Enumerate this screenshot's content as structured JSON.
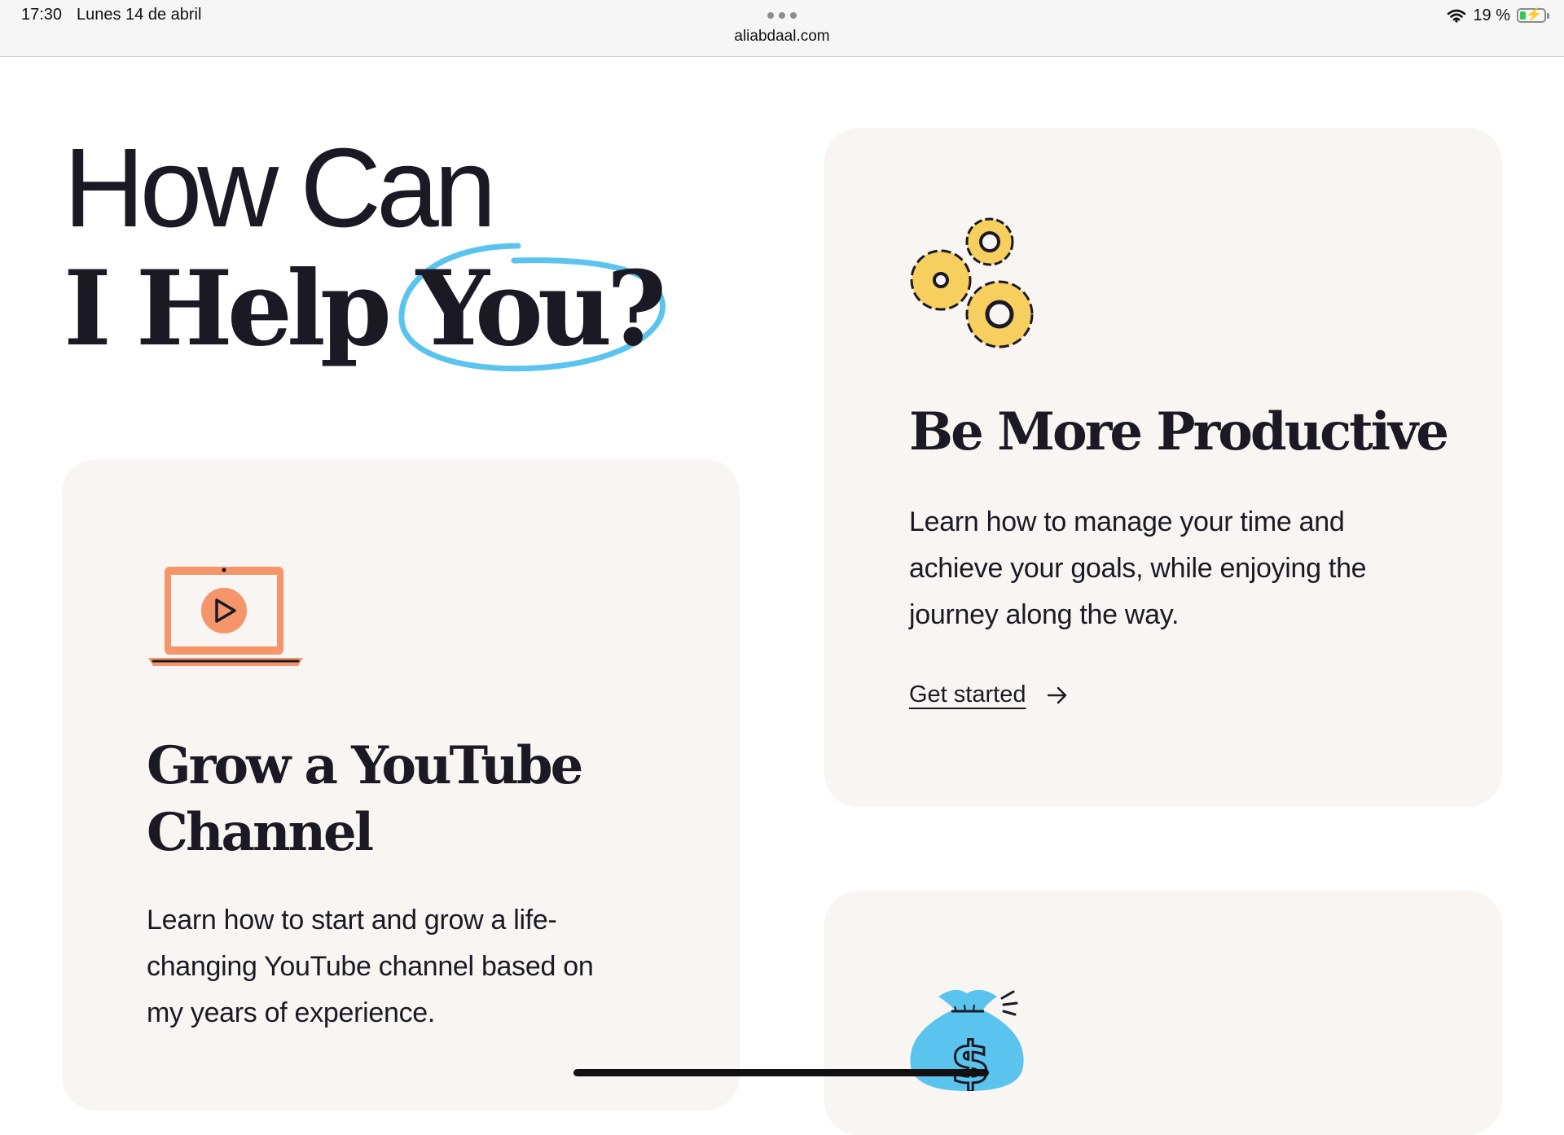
{
  "status_bar": {
    "time": "17:30",
    "date": "Lunes 14 de abril",
    "url": "aliabdaal.com",
    "battery": "19 %",
    "wifi_icon": "wifi-icon",
    "battery_icon": "battery-charging-icon"
  },
  "headline": {
    "line1": "How Can",
    "line2_part1": "I Help ",
    "line2_highlight": "You?",
    "highlight_color": "#5bc4ee"
  },
  "cards": {
    "youtube": {
      "icon": "laptop-play-icon",
      "title_line1": "Grow a YouTube",
      "title_line2": "Channel",
      "desc_line1": "Learn how to start and grow a life-",
      "desc_line2": "changing YouTube channel based on",
      "desc_line3": "my years of experience.",
      "accent": "#f4956a"
    },
    "productive": {
      "icon": "gears-icon",
      "title": "Be More Productive",
      "desc_line1": "Learn how to manage your time and",
      "desc_line2": "achieve your goals, while enjoying the",
      "desc_line3": "journey along the way.",
      "cta": "Get started",
      "cta_icon": "arrow-right-icon",
      "accent": "#f7cf5e"
    },
    "money": {
      "icon": "money-bag-icon",
      "accent": "#5bc4ee"
    }
  },
  "colors": {
    "card_background": "#f8f5f2",
    "text": "#1b1a24"
  }
}
